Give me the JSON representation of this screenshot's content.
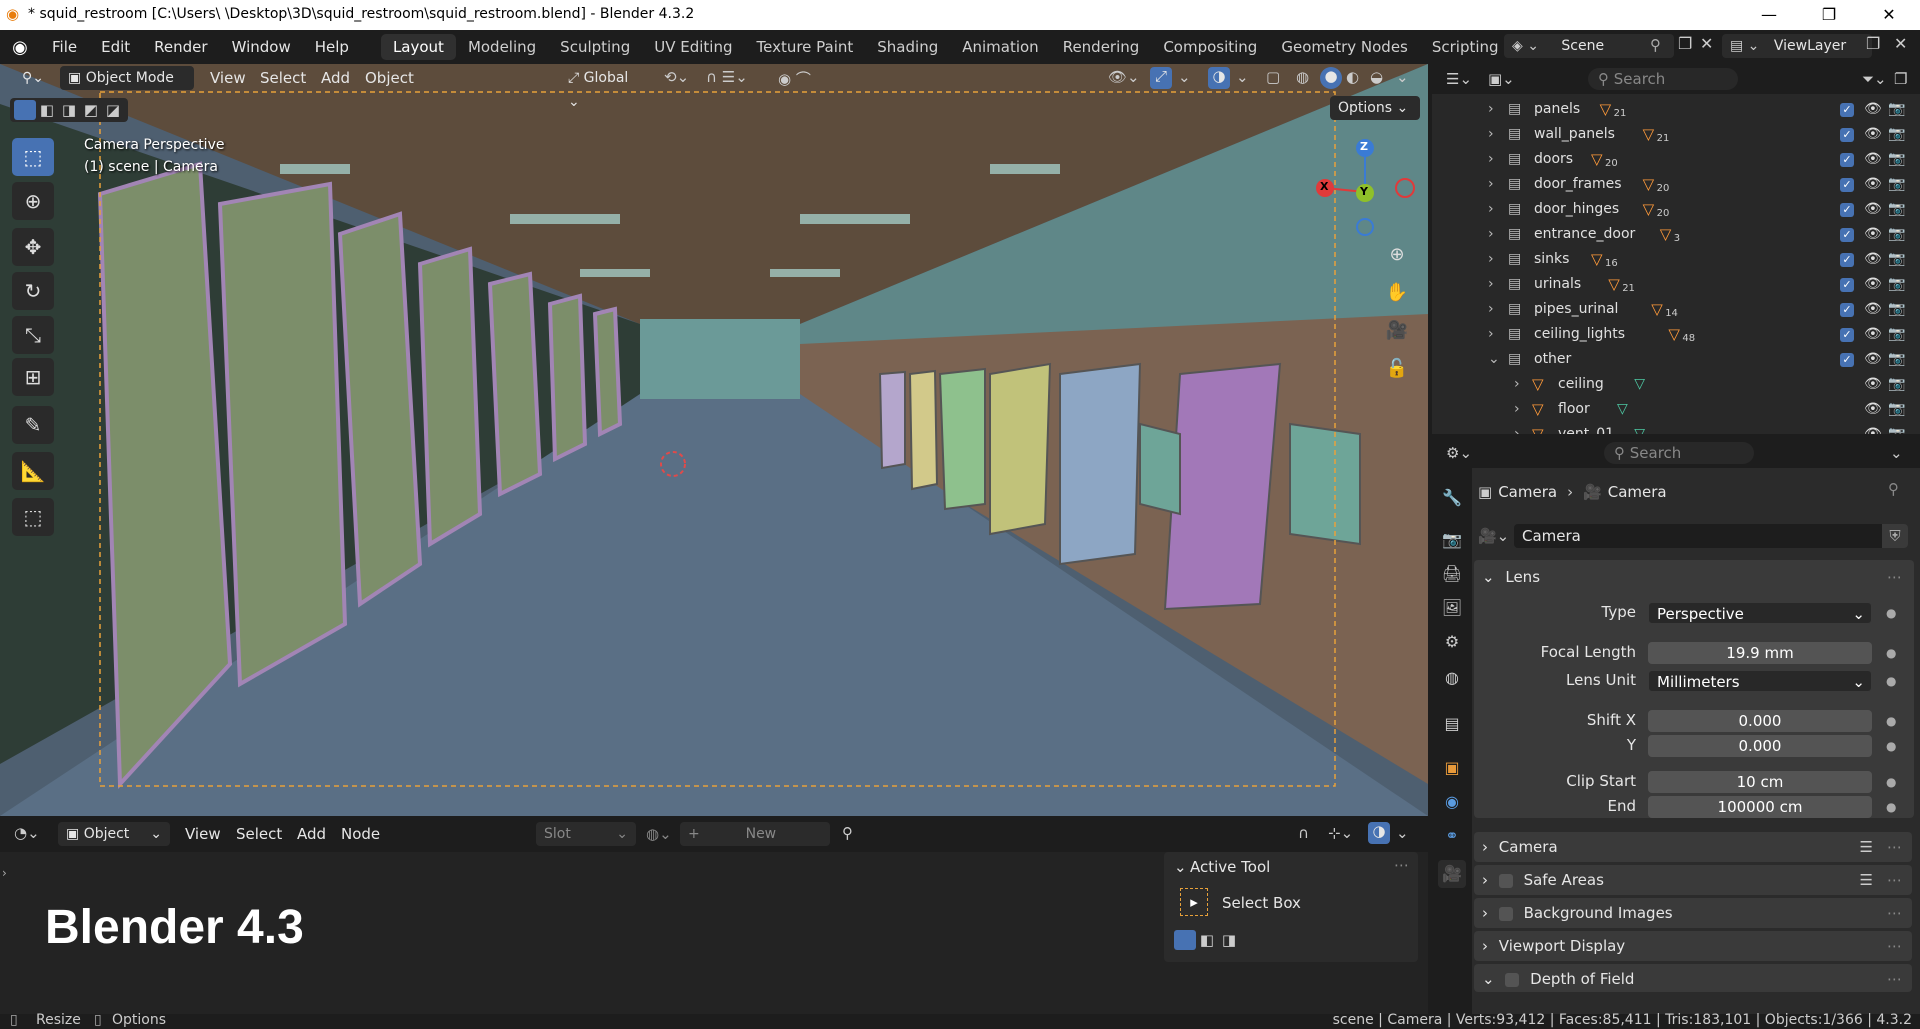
{
  "window": {
    "title": "* squid_restroom [C:\\Users\\        \\Desktop\\3D\\squid_restroom\\squid_restroom.blend] - Blender 4.3.2",
    "min": "—",
    "max": "❐",
    "close": "✕"
  },
  "menu": [
    "File",
    "Edit",
    "Render",
    "Window",
    "Help"
  ],
  "workspaces": [
    "Layout",
    "Modeling",
    "Sculpting",
    "UV Editing",
    "Texture Paint",
    "Shading",
    "Animation",
    "Rendering",
    "Compositing",
    "Geometry Nodes",
    "Scripting"
  ],
  "active_workspace": "Layout",
  "add_tab": "+",
  "scene": {
    "label": "Scene",
    "viewlayer": "ViewLayer"
  },
  "viewport": {
    "mode": "Object Mode",
    "menus": [
      "View",
      "Select",
      "Add",
      "Object"
    ],
    "orientation": "Global",
    "options": "Options",
    "overlay_title": "Camera Perspective",
    "overlay_sub": "(1) scene | Camera",
    "gizmo": {
      "z": "Z",
      "y": "Y",
      "x": "X"
    }
  },
  "bottom_editor": {
    "type": "Object",
    "menus": [
      "View",
      "Select",
      "Add",
      "Node"
    ],
    "slot": "Slot",
    "new": "New",
    "big_label": "Blender 4.3"
  },
  "active_tool": {
    "title": "Active Tool",
    "tool": "Select Box"
  },
  "outliner": {
    "search": "Search",
    "items": [
      {
        "name": "panels",
        "count": "21"
      },
      {
        "name": "wall_panels",
        "count": "21"
      },
      {
        "name": "doors",
        "count": "20"
      },
      {
        "name": "door_frames",
        "count": "20"
      },
      {
        "name": "door_hinges",
        "count": "20"
      },
      {
        "name": "entrance_door",
        "count": "3"
      },
      {
        "name": "sinks",
        "count": "16"
      },
      {
        "name": "urinals",
        "count": "21"
      },
      {
        "name": "pipes_urinal",
        "count": "14"
      },
      {
        "name": "ceiling_lights",
        "count": "48"
      },
      {
        "name": "other",
        "count": ""
      }
    ],
    "children": [
      "ceiling",
      "floor",
      "vent_01"
    ]
  },
  "properties": {
    "search": "Search",
    "breadcrumb": [
      "Camera",
      "Camera"
    ],
    "data_name": "Camera",
    "lens_panel": "Lens",
    "type_label": "Type",
    "type_value": "Perspective",
    "focal_label": "Focal Length",
    "focal_value": "19.9 mm",
    "unit_label": "Lens Unit",
    "unit_value": "Millimeters",
    "shiftx_label": "Shift X",
    "shiftx_value": "0.000",
    "shifty_label": "Y",
    "shifty_value": "0.000",
    "clipstart_label": "Clip Start",
    "clipstart_value": "10 cm",
    "clipend_label": "End",
    "clipend_value": "100000 cm",
    "panels": [
      "Camera",
      "Safe Areas",
      "Background Images",
      "Viewport Display",
      "Depth of Field"
    ]
  },
  "statusbar": {
    "resize": "Resize",
    "options": "Options",
    "stats": "scene | Camera | Verts:93,412 | Faces:85,411 | Tris:183,101 | Objects:1/366 | 4.3.2"
  }
}
